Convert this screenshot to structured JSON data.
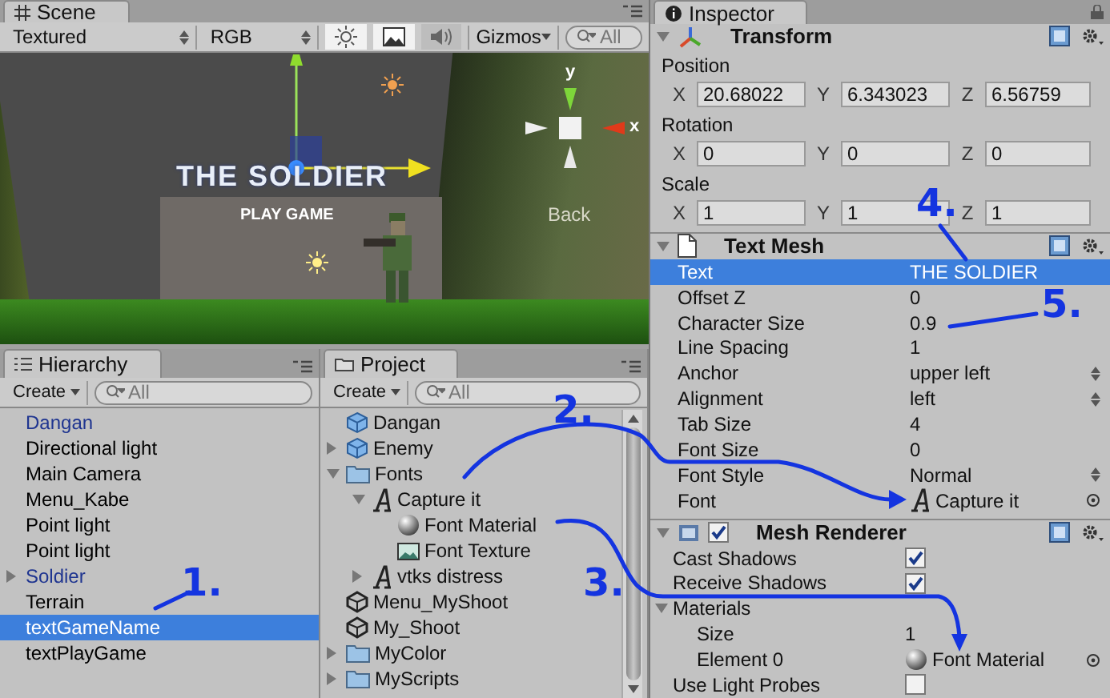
{
  "scene_panel": {
    "tab": "Scene",
    "render_mode": "Textured",
    "color_mode": "RGB",
    "gizmos": "Gizmos",
    "search": {
      "placeholder": "All"
    },
    "toggles": [
      {
        "kind": "light",
        "on": true
      },
      {
        "kind": "image",
        "on": true
      },
      {
        "kind": "audio",
        "on": false
      }
    ],
    "axis_labels": [
      "y",
      "x"
    ],
    "viewport_texts": [
      "THE SOLDIER",
      "PLAY GAME",
      "Back"
    ]
  },
  "hierarchy": {
    "tab": "Hierarchy",
    "create": "Create",
    "search": {
      "placeholder": "All"
    },
    "items": [
      {
        "label": "Dangan",
        "kind": "prefab",
        "selected": false
      },
      {
        "label": "Directional light",
        "kind": "object",
        "selected": false
      },
      {
        "label": "Main Camera",
        "kind": "object",
        "selected": false
      },
      {
        "label": "Menu_Kabe",
        "kind": "object",
        "selected": false
      },
      {
        "label": "Point light",
        "kind": "object",
        "selected": false
      },
      {
        "label": "Point light",
        "kind": "object",
        "selected": false
      },
      {
        "label": "Soldier",
        "kind": "prefab",
        "expanded": false,
        "selected": false
      },
      {
        "label": "Terrain",
        "kind": "object",
        "selected": false
      },
      {
        "label": "textGameName",
        "kind": "object",
        "selected": true
      },
      {
        "label": "textPlayGame",
        "kind": "object",
        "selected": false
      }
    ]
  },
  "project": {
    "tab": "Project",
    "create": "Create",
    "search": {
      "placeholder": "All"
    },
    "items": [
      {
        "label": "Dangan",
        "kind": "prefab"
      },
      {
        "label": "Enemy",
        "kind": "prefab",
        "expanded": false
      },
      {
        "label": "Fonts",
        "kind": "folder",
        "expanded": true,
        "children": [
          {
            "label": "Capture it",
            "kind": "font",
            "expanded": true,
            "children": [
              {
                "label": "Font Material",
                "kind": "material"
              },
              {
                "label": "Font Texture",
                "kind": "texture"
              }
            ]
          },
          {
            "label": "vtks distress",
            "kind": "font",
            "expanded": false
          }
        ]
      },
      {
        "label": "Menu_MyShoot",
        "kind": "scene"
      },
      {
        "label": "My_Shoot",
        "kind": "scene"
      },
      {
        "label": "MyColor",
        "kind": "folder",
        "expanded": false
      },
      {
        "label": "MyScripts",
        "kind": "folder",
        "expanded": false
      }
    ]
  },
  "inspector": {
    "tab": "Inspector",
    "transform": {
      "title": "Transform",
      "groups": [
        {
          "label": "Position",
          "fields": [
            {
              "axis": "X",
              "value": "20.68022"
            },
            {
              "axis": "Y",
              "value": "6.343023"
            },
            {
              "axis": "Z",
              "value": "6.56759"
            }
          ]
        },
        {
          "label": "Rotation",
          "fields": [
            {
              "axis": "X",
              "value": "0"
            },
            {
              "axis": "Y",
              "value": "0"
            },
            {
              "axis": "Z",
              "value": "0"
            }
          ]
        },
        {
          "label": "Scale",
          "fields": [
            {
              "axis": "X",
              "value": "1"
            },
            {
              "axis": "Y",
              "value": "1"
            },
            {
              "axis": "Z",
              "value": "1"
            }
          ]
        }
      ]
    },
    "text_mesh": {
      "title": "Text Mesh",
      "rows": [
        {
          "label": "Text",
          "value": "THE SOLDIER",
          "kind": "text",
          "selected": true
        },
        {
          "label": "Offset Z",
          "value": "0",
          "kind": "text",
          "selected": false
        },
        {
          "label": "Character Size",
          "value": "0.9",
          "kind": "text",
          "selected": false
        },
        {
          "label": "Line Spacing",
          "value": "1",
          "kind": "text",
          "selected": false
        },
        {
          "label": "Anchor",
          "value": "upper left",
          "kind": "popup",
          "selected": false
        },
        {
          "label": "Alignment",
          "value": "left",
          "kind": "popup",
          "selected": false
        },
        {
          "label": "Tab Size",
          "value": "4",
          "kind": "text",
          "selected": false
        },
        {
          "label": "Font Size",
          "value": "0",
          "kind": "text",
          "selected": false
        },
        {
          "label": "Font Style",
          "value": "Normal",
          "kind": "popup",
          "selected": false
        },
        {
          "label": "Font",
          "value": "Capture it",
          "kind": "font",
          "selected": false
        }
      ]
    },
    "mesh_renderer": {
      "title": "Mesh Renderer",
      "enabled": true,
      "rows": [
        {
          "label": "Cast Shadows",
          "kind": "toggle",
          "checked": true
        },
        {
          "label": "Receive Shadows",
          "kind": "toggle",
          "checked": true
        },
        {
          "label": "Materials",
          "kind": "foldout",
          "expanded": true,
          "children": [
            {
              "label": "Size",
              "kind": "text",
              "value": "1"
            },
            {
              "label": "Element 0",
              "kind": "material",
              "value": "Font Material"
            }
          ]
        },
        {
          "label": "Use Light Probes",
          "kind": "toggle",
          "checked": false
        }
      ]
    }
  },
  "annotations": [
    {
      "label": "1."
    },
    {
      "label": "2."
    },
    {
      "label": "3."
    },
    {
      "label": "4."
    },
    {
      "label": "5."
    }
  ]
}
